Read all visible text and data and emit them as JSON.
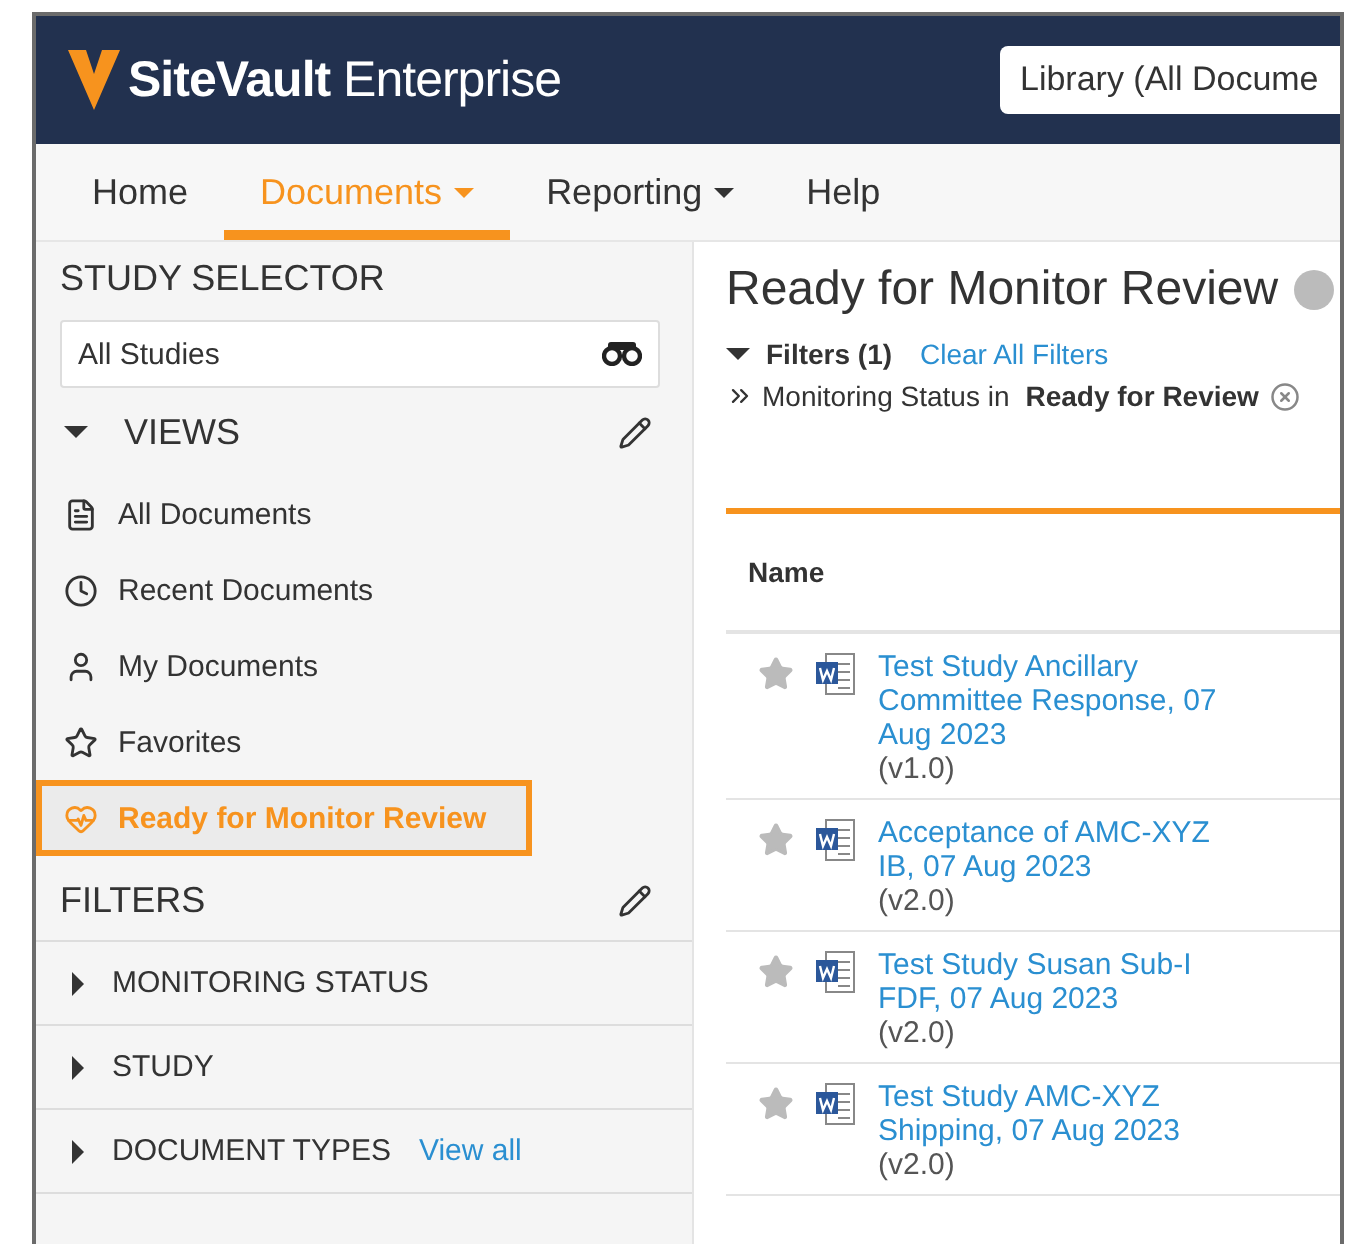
{
  "header": {
    "brand": "**SiteVault** Enterprise",
    "library_select": {
      "value": "Library (All Docume"
    }
  },
  "nav": [
    {
      "label": "Home",
      "selected": false,
      "dropdown": false
    },
    {
      "label": "Documents",
      "selected": true,
      "dropdown": true
    },
    {
      "label": "Reporting",
      "selected": false,
      "dropdown": true
    },
    {
      "label": "Help",
      "selected": false,
      "dropdown": false
    }
  ],
  "sidebar": {
    "study_selector": {
      "title": "STUDY SELECTOR",
      "value": "All Studies"
    },
    "views": {
      "title": "VIEWS",
      "expanded": true,
      "items": [
        {
          "label": "All Documents",
          "kind": "document",
          "selected": false
        },
        {
          "label": "Recent Documents",
          "kind": "clock",
          "selected": false
        },
        {
          "label": "My Documents",
          "kind": "user",
          "selected": false
        },
        {
          "label": "Favorites",
          "kind": "star",
          "selected": false
        },
        {
          "label": "Ready for Monitor Review",
          "kind": "heartbeat",
          "selected": true
        }
      ]
    },
    "filters": {
      "title": "FILTERS",
      "items": [
        {
          "label": "MONITORING STATUS",
          "expanded": false
        },
        {
          "label": "STUDY",
          "expanded": false
        },
        {
          "label": "DOCUMENT TYPES",
          "expanded": false,
          "link": "View all"
        }
      ]
    }
  },
  "main": {
    "title": "Ready for Monitor Review",
    "filters_toggle": "Filters (1)",
    "clear_link": "Clear All Filters",
    "active_filter": {
      "field": "Monitoring Status in",
      "value": "Ready for Review"
    },
    "table": {
      "columns": [
        "Name"
      ],
      "rows": [
        {
          "favorite": false,
          "title": "Test Study Ancillary Committee Response, 07 Aug 2023",
          "version": "(v1.0)"
        },
        {
          "favorite": false,
          "title": "Acceptance of AMC-XYZ IB, 07 Aug 2023",
          "version": "(v2.0)"
        },
        {
          "favorite": false,
          "title": "Test Study Susan Sub-I FDF, 07 Aug 2023",
          "version": "(v2.0)"
        },
        {
          "favorite": false,
          "title": "Test Study AMC-XYZ Shipping, 07 Aug 2023",
          "version": "(v2.0)"
        }
      ]
    }
  }
}
